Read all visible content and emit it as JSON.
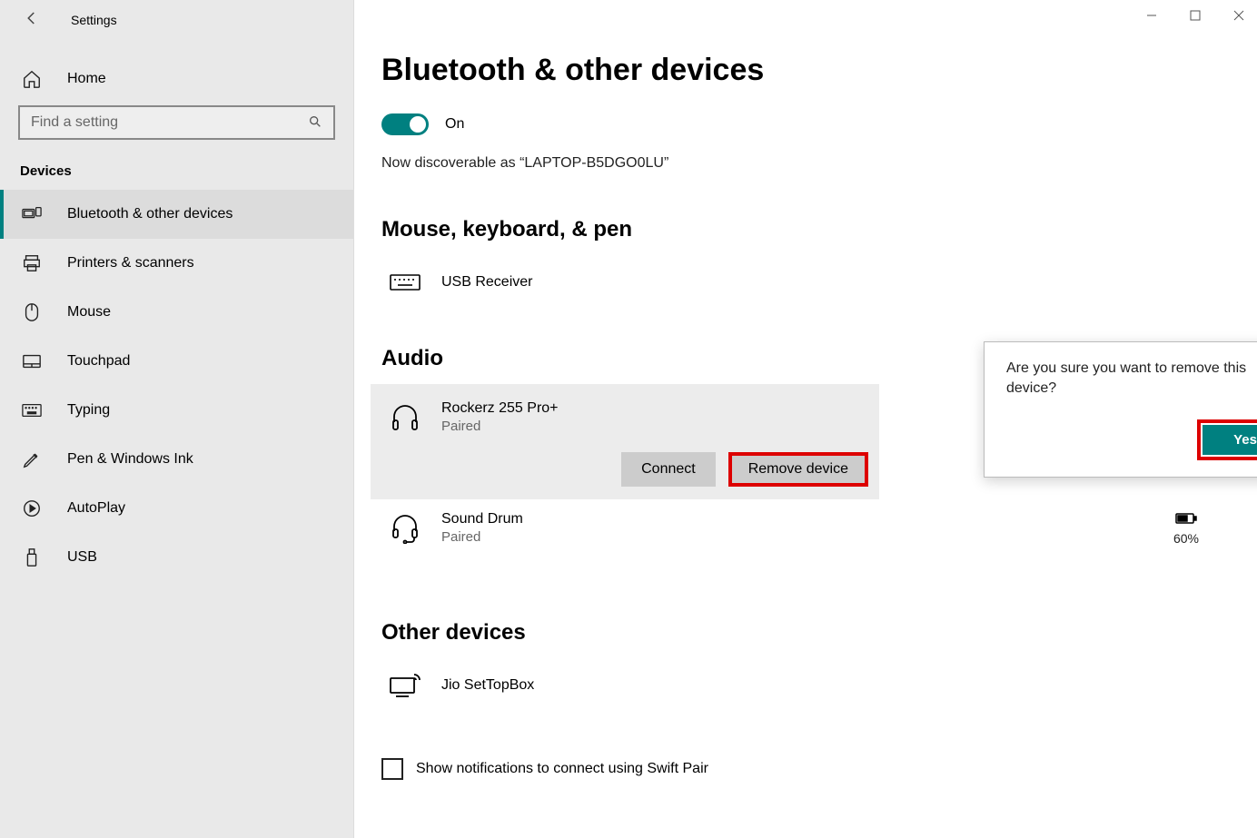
{
  "window": {
    "app_title": "Settings"
  },
  "sidebar": {
    "home_label": "Home",
    "search_placeholder": "Find a setting",
    "section_label": "Devices",
    "items": [
      {
        "label": "Bluetooth & other devices"
      },
      {
        "label": "Printers & scanners"
      },
      {
        "label": "Mouse"
      },
      {
        "label": "Touchpad"
      },
      {
        "label": "Typing"
      },
      {
        "label": "Pen & Windows Ink"
      },
      {
        "label": "AutoPlay"
      },
      {
        "label": "USB"
      }
    ]
  },
  "main": {
    "page_title": "Bluetooth & other devices",
    "toggle_label": "On",
    "discoverable": "Now discoverable as “LAPTOP-B5DGO0LU”",
    "sections": {
      "mouse_kb": {
        "title": "Mouse, keyboard, & pen",
        "devices": [
          {
            "name": "USB Receiver"
          }
        ]
      },
      "audio": {
        "title": "Audio",
        "devices": [
          {
            "name": "Rockerz 255 Pro+",
            "status": "Paired"
          },
          {
            "name": "Sound Drum",
            "status": "Paired",
            "battery": "60%"
          }
        ]
      },
      "other": {
        "title": "Other devices",
        "devices": [
          {
            "name": "Jio SetTopBox"
          }
        ]
      }
    },
    "actions": {
      "connect": "Connect",
      "remove": "Remove device"
    },
    "popup": {
      "text": "Are you sure you want to remove this device?",
      "yes": "Yes"
    },
    "swift_pair_label": "Show notifications to connect using Swift Pair"
  }
}
